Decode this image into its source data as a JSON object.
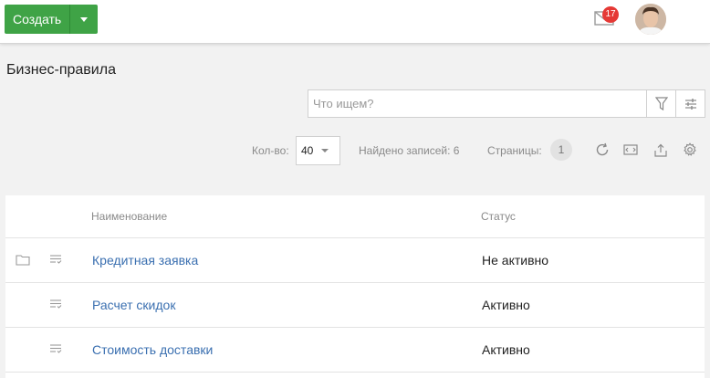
{
  "topbar": {
    "create_label": "Создать",
    "notifications_count": "17"
  },
  "page": {
    "title": "Бизнес-правила"
  },
  "search": {
    "placeholder": "Что ищем?"
  },
  "pager": {
    "qty_label": "Кол-во:",
    "qty_value": "40",
    "found_label": "Найдено записей: 6",
    "pages_label": "Страницы:",
    "page_current": "1"
  },
  "table": {
    "columns": {
      "name": "Наименование",
      "status": "Статус"
    },
    "rows": [
      {
        "name": "Кредитная заявка",
        "status": "Не активно",
        "has_folder": true
      },
      {
        "name": "Расчет скидок",
        "status": "Активно",
        "has_folder": false
      },
      {
        "name": "Стоимость доставки",
        "status": "Активно",
        "has_folder": false
      }
    ]
  },
  "colors": {
    "accent_green": "#3fa346",
    "link_blue": "#3a6fb0",
    "badge_red": "#e53935"
  }
}
